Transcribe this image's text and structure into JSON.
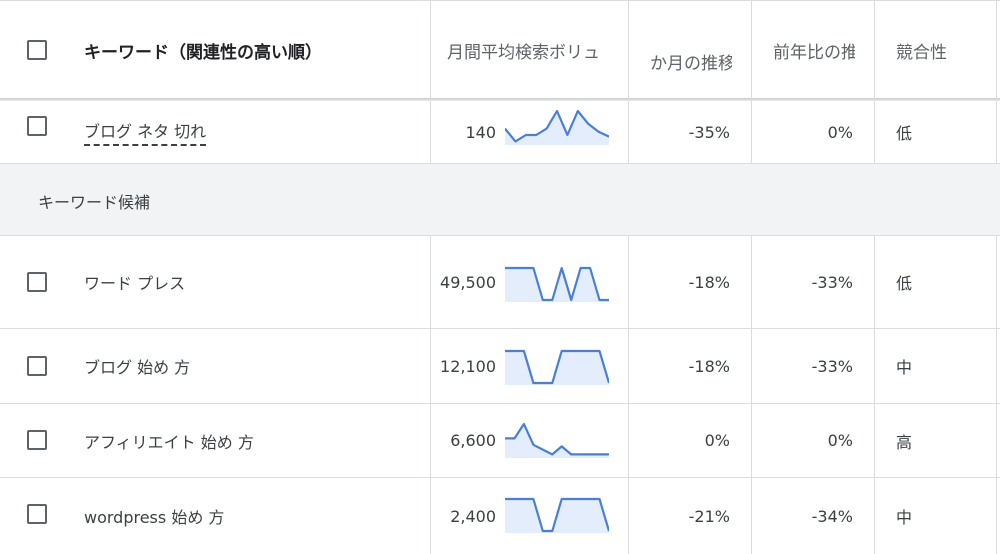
{
  "header": {
    "keyword": "キーワード（関連性の高い順）",
    "monthly_volume": "月間平均検索ボリュ",
    "three_month": "か月の推移",
    "yoy": "前年比の推",
    "competition": "競合性"
  },
  "pinned_row": {
    "keyword": "ブログ ネタ 切れ",
    "volume": "140",
    "three_month": "-35%",
    "yoy": "0%",
    "competition": "低",
    "trend": [
      0.45,
      0.05,
      0.25,
      0.25,
      0.45,
      1.0,
      0.25,
      1.0,
      0.6,
      0.35,
      0.2
    ]
  },
  "section": {
    "label": "キーワード候補"
  },
  "rows": [
    {
      "keyword": "ワード プレス",
      "volume": "49,500",
      "three_month": "-18%",
      "yoy": "-33%",
      "competition": "低",
      "trend": [
        1,
        1,
        1,
        1,
        0,
        0,
        1,
        0,
        1,
        1,
        0,
        0
      ]
    },
    {
      "keyword": "ブログ 始め 方",
      "volume": "12,100",
      "three_month": "-18%",
      "yoy": "-33%",
      "competition": "中",
      "trend": [
        1,
        1,
        1,
        0,
        0,
        0,
        1,
        1,
        1,
        1,
        1,
        0
      ]
    },
    {
      "keyword": "アフィリエイト 始め 方",
      "volume": "6,600",
      "three_month": "0%",
      "yoy": "0%",
      "competition": "高",
      "trend": [
        0.55,
        0.55,
        1.0,
        0.35,
        0.2,
        0.05,
        0.3,
        0.05,
        0.05,
        0.05,
        0.05,
        0.05
      ]
    },
    {
      "keyword": "wordpress 始め 方",
      "volume": "2,400",
      "three_month": "-21%",
      "yoy": "-34%",
      "competition": "中",
      "trend": [
        1,
        1,
        1,
        1,
        0,
        0,
        1,
        1,
        1,
        1,
        1,
        0
      ]
    }
  ],
  "colors": {
    "sparkline_stroke": "#4a7fd4",
    "sparkline_fill": "#e4edfb",
    "section_bg": "#f1f3f4",
    "border": "#dadce0"
  }
}
